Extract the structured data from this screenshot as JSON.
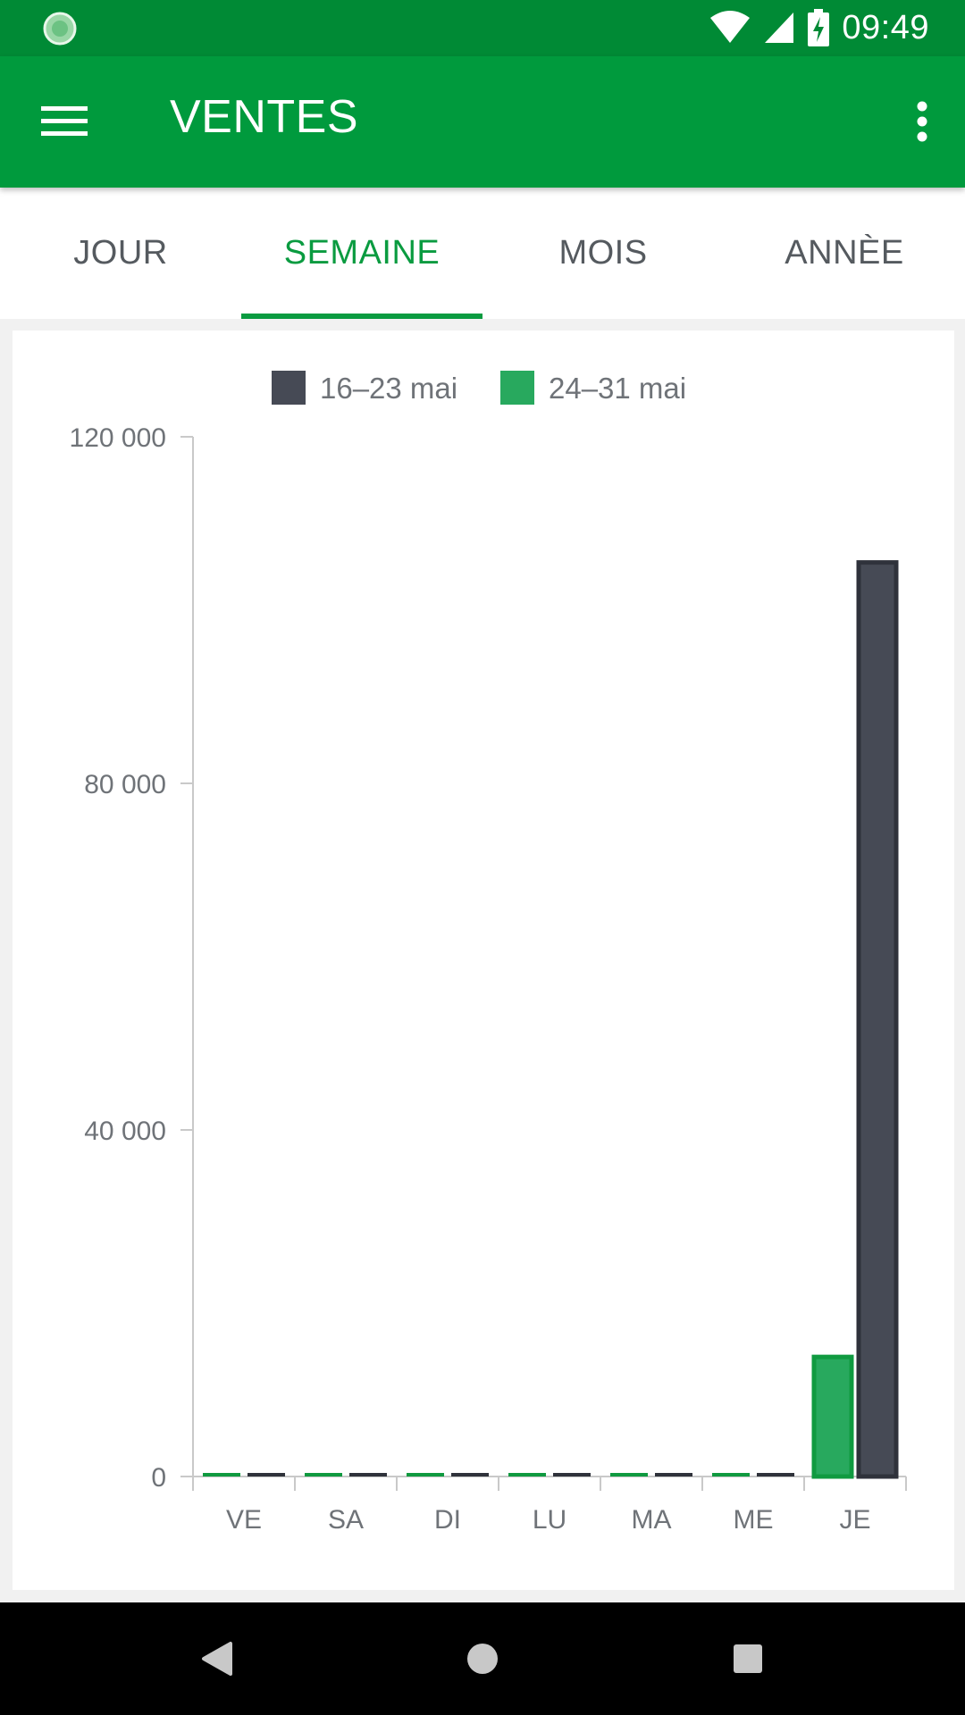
{
  "status_bar": {
    "time": "09:49"
  },
  "app_bar": {
    "title": "VENTES"
  },
  "tabs": [
    {
      "label": "JOUR",
      "active": false
    },
    {
      "label": "SEMAINE",
      "active": true
    },
    {
      "label": "MOIS",
      "active": false
    },
    {
      "label": "ANNÈE",
      "active": false
    }
  ],
  "colors": {
    "status_bar": "#008a35",
    "app_bar": "#009a3d",
    "accent": "#0a9b40",
    "series_dark": "#464a55",
    "series_green": "#28a95e"
  },
  "chart_data": {
    "type": "bar",
    "categories": [
      "VE",
      "SA",
      "DI",
      "LU",
      "MA",
      "ME",
      "JE"
    ],
    "series": [
      {
        "name": "16–23 mai",
        "color": "#464a55",
        "values": [
          0,
          0,
          0,
          0,
          0,
          0,
          105500
        ]
      },
      {
        "name": "24–31 mai",
        "color": "#28a95e",
        "values": [
          0,
          0,
          0,
          0,
          0,
          0,
          13800
        ]
      }
    ],
    "yticks": [
      "0",
      "40 000",
      "80 000",
      "120 000"
    ],
    "ytick_values": [
      0,
      40000,
      80000,
      120000
    ],
    "ylim": [
      0,
      120000
    ],
    "legend": "top"
  }
}
